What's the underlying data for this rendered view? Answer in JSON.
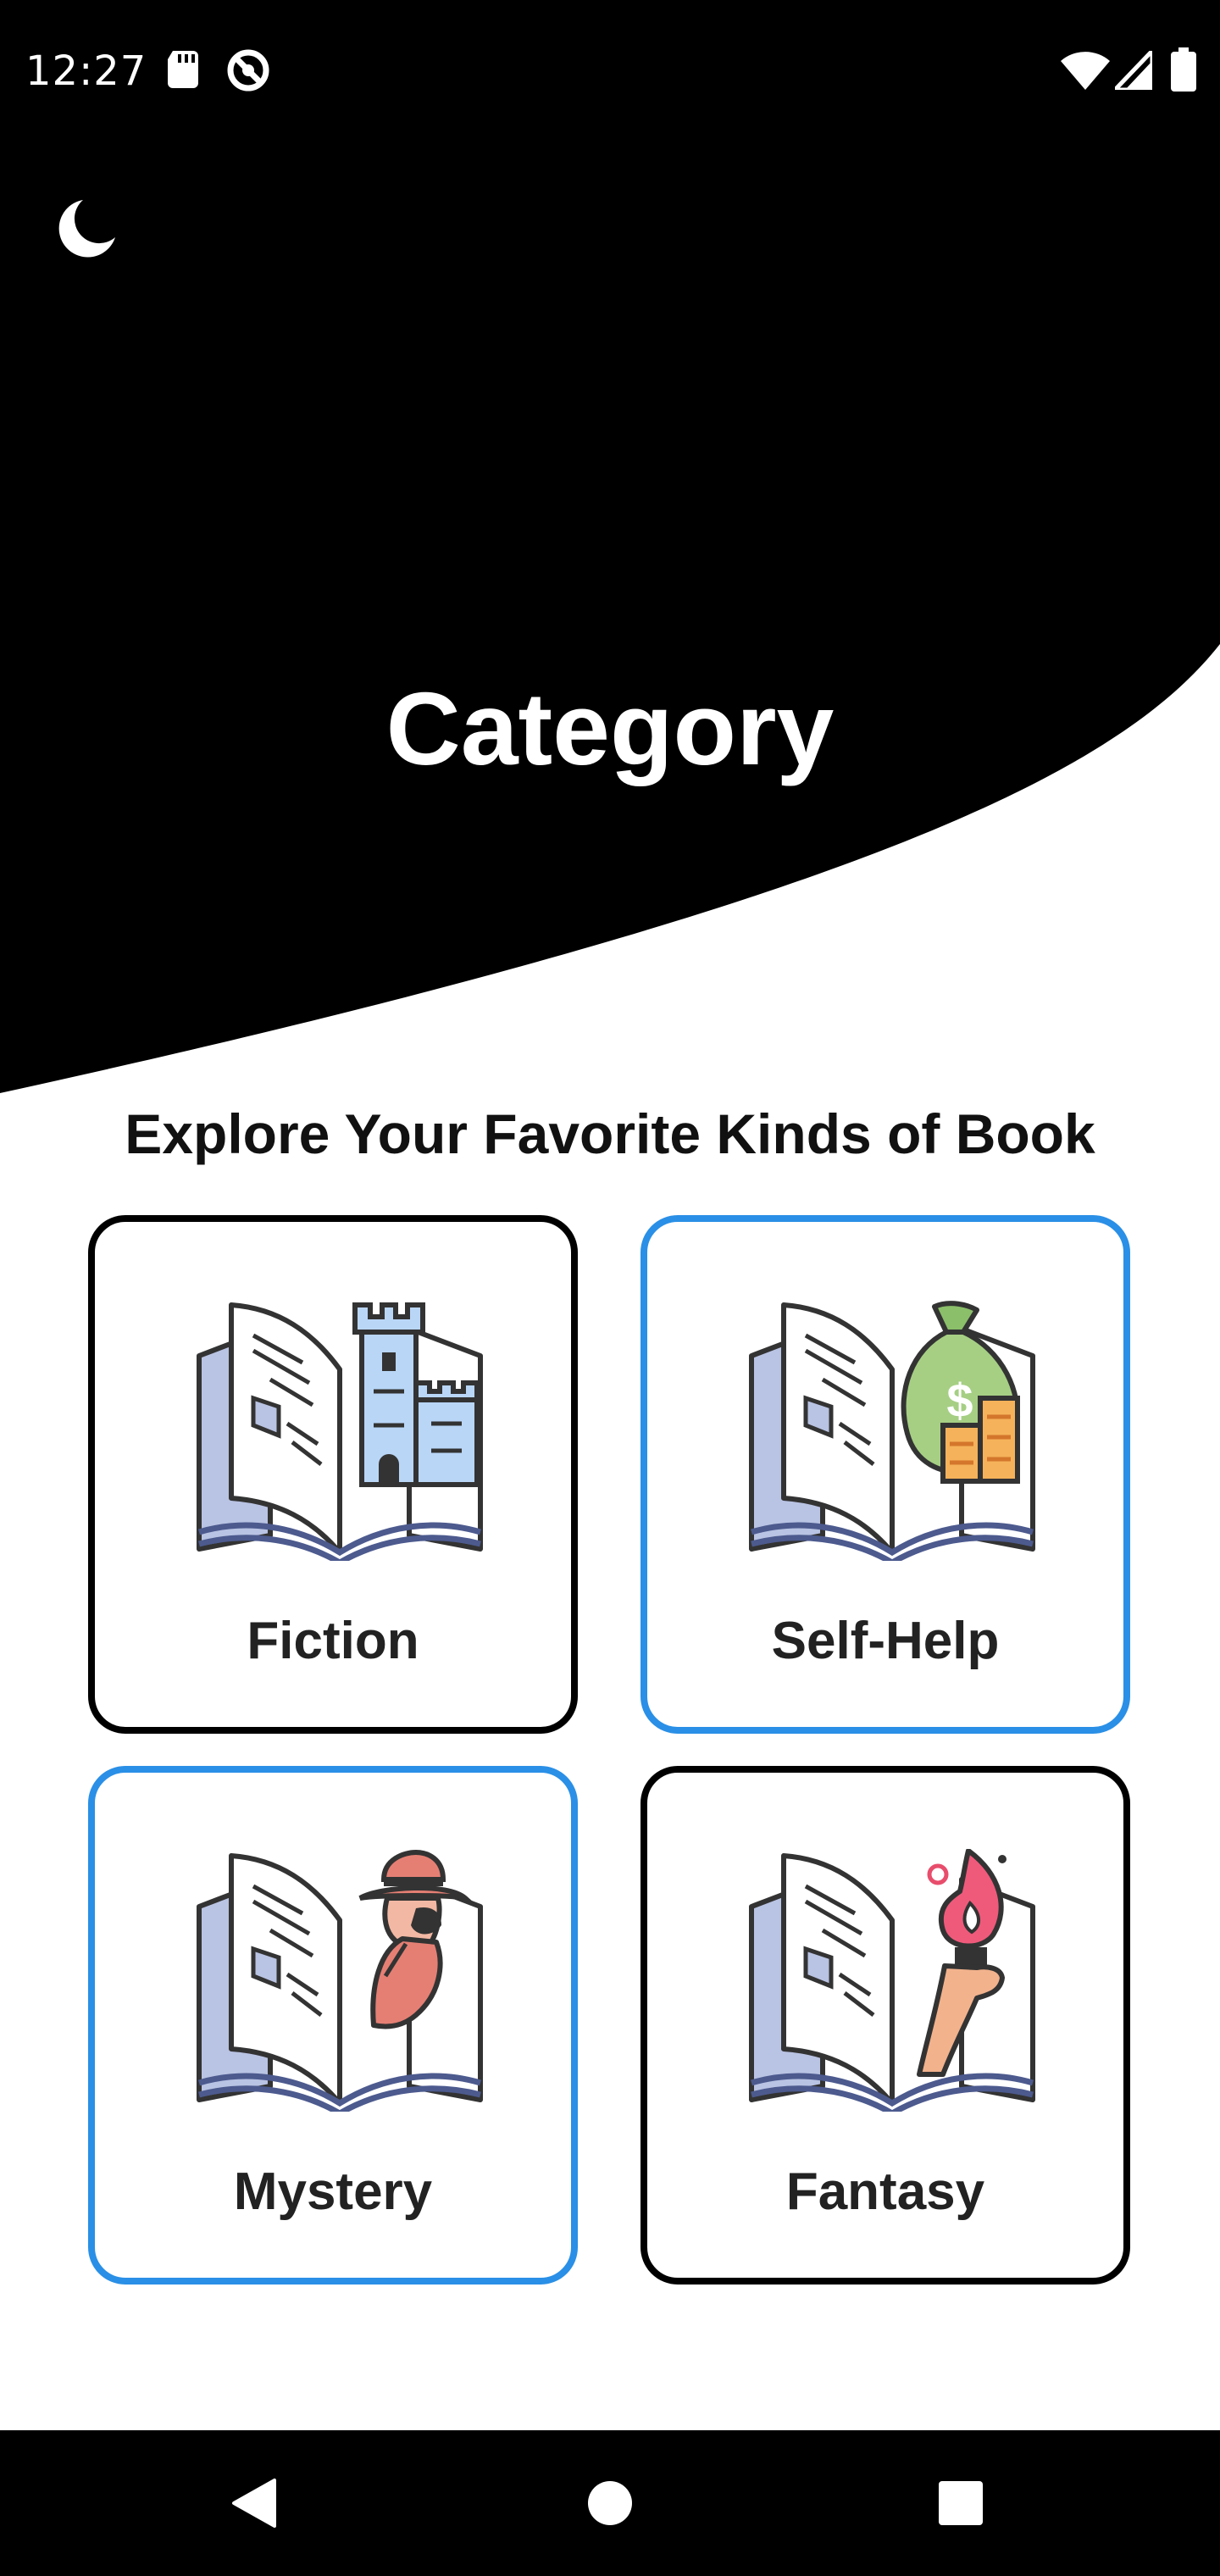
{
  "status_bar": {
    "time": "12:27",
    "icons": [
      "sd-card-icon",
      "do-not-disturb-icon",
      "wifi-icon",
      "cell-signal-icon",
      "battery-icon"
    ]
  },
  "header": {
    "theme_toggle_icon": "moon-icon",
    "title": "Category",
    "background_color": "#000000"
  },
  "main": {
    "subtitle": "Explore Your Favorite Kinds of Book",
    "categories": [
      {
        "label": "Fiction",
        "icon": "book-castle-icon",
        "selected": false
      },
      {
        "label": "Self-Help",
        "icon": "book-money-bag-icon",
        "selected": true
      },
      {
        "label": "Mystery",
        "icon": "book-detective-icon",
        "selected": true
      },
      {
        "label": "Fantasy",
        "icon": "book-torch-icon",
        "selected": false
      }
    ],
    "selected_border_color": "#2a8fe6",
    "default_border_color": "#000000"
  },
  "navigation_bar": {
    "buttons": [
      "back-icon",
      "home-icon",
      "recents-icon"
    ]
  }
}
